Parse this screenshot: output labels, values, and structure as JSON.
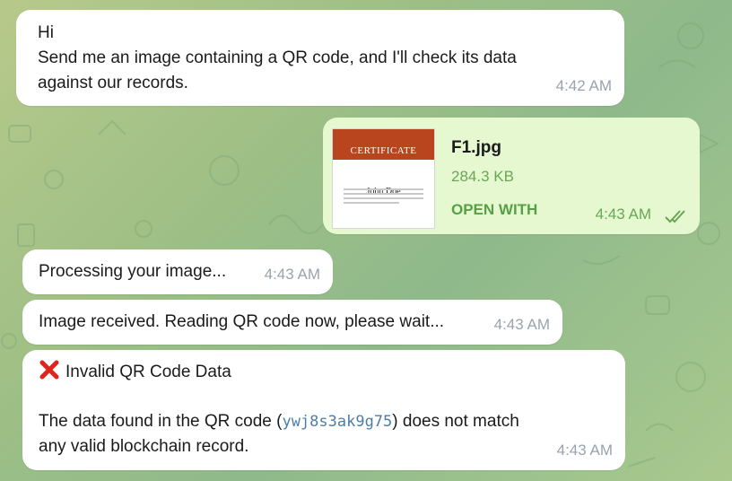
{
  "messages": {
    "welcome": {
      "text": "Hi\nSend me an image containing a QR code, and I'll check its data\nagainst our records.",
      "time": "4:42 AM"
    },
    "file": {
      "name": "F1.jpg",
      "size": "284.3 KB",
      "action": "OPEN WITH",
      "time": "4:43 AM",
      "thumb": {
        "title": "CERTIFICATE",
        "recipient": "John Doe"
      }
    },
    "processing": {
      "text": "Processing your image...",
      "time": "4:43 AM"
    },
    "received": {
      "text": "Image received. Reading QR code now, please wait...",
      "time": "4:43 AM"
    },
    "invalid": {
      "title": "Invalid QR Code Data",
      "body_pre": "The data found in the QR code (",
      "code": "ywj8s3ak9g75",
      "body_post": ") does not match\nany valid blockchain record.",
      "time": "4:43 AM"
    }
  },
  "colors": {
    "outgoing_bubble": "#e6f8cf",
    "incoming_bubble": "#ffffff",
    "accent_green": "#58a047",
    "error_red": "#e0241b",
    "code_blue": "#4d7ea8"
  }
}
